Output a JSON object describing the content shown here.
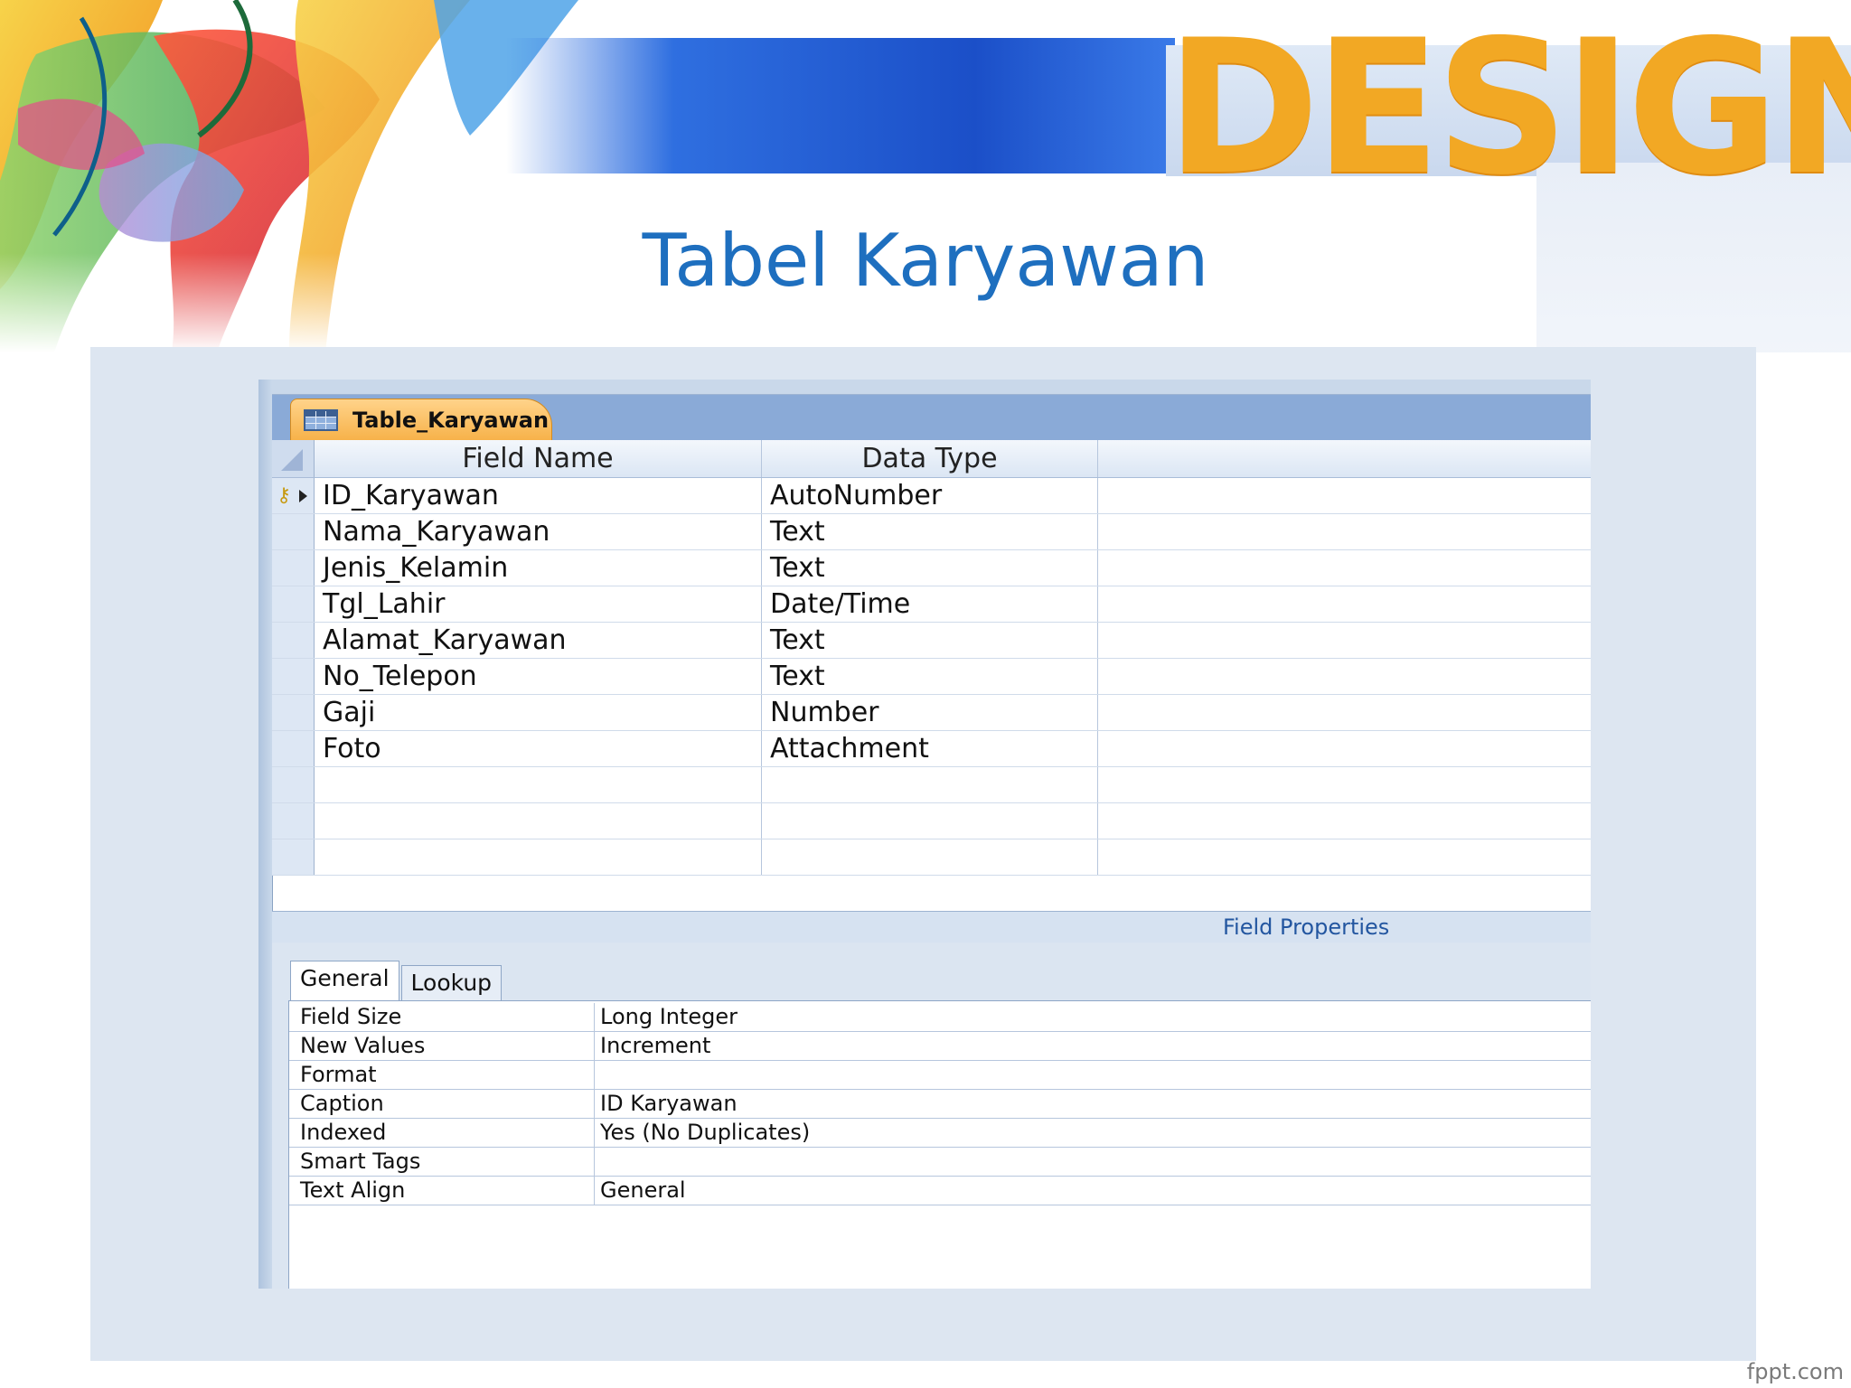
{
  "slide": {
    "title": "Tabel Karyawan",
    "banner_word": "DESIGN",
    "watermark": "fppt.com"
  },
  "colors": {
    "title_blue": "#1e6fbf",
    "design_orange": "#f2a824",
    "tab_orange": "#f7b24a",
    "ribbon_blue": "#8aaad7",
    "panel_bg": "#dde6f1"
  },
  "window": {
    "document_tab": {
      "label": "Table_Karyawan",
      "icon": "table-icon"
    },
    "grid": {
      "headers": {
        "field_name": "Field Name",
        "data_type": "Data Type",
        "description": ""
      },
      "rows": [
        {
          "field_name": "ID_Karyawan",
          "data_type": "AutoNumber",
          "description": "",
          "primary_key": true,
          "current": true
        },
        {
          "field_name": "Nama_Karyawan",
          "data_type": "Text",
          "description": ""
        },
        {
          "field_name": "Jenis_Kelamin",
          "data_type": "Text",
          "description": ""
        },
        {
          "field_name": "Tgl_Lahir",
          "data_type": "Date/Time",
          "description": ""
        },
        {
          "field_name": "Alamat_Karyawan",
          "data_type": "Text",
          "description": ""
        },
        {
          "field_name": "No_Telepon",
          "data_type": "Text",
          "description": ""
        },
        {
          "field_name": "Gaji",
          "data_type": "Number",
          "description": ""
        },
        {
          "field_name": "Foto",
          "data_type": "Attachment",
          "description": ""
        },
        {
          "field_name": "",
          "data_type": "",
          "description": ""
        },
        {
          "field_name": "",
          "data_type": "",
          "description": ""
        },
        {
          "field_name": "",
          "data_type": "",
          "description": ""
        }
      ]
    },
    "field_properties": {
      "title": "Field Properties",
      "tabs": [
        {
          "label": "General",
          "active": true
        },
        {
          "label": "Lookup",
          "active": false
        }
      ],
      "properties": [
        {
          "name": "Field Size",
          "value": "Long Integer"
        },
        {
          "name": "New Values",
          "value": "Increment"
        },
        {
          "name": "Format",
          "value": ""
        },
        {
          "name": "Caption",
          "value": "ID Karyawan"
        },
        {
          "name": "Indexed",
          "value": "Yes (No Duplicates)"
        },
        {
          "name": "Smart Tags",
          "value": ""
        },
        {
          "name": "Text Align",
          "value": "General"
        }
      ]
    }
  }
}
